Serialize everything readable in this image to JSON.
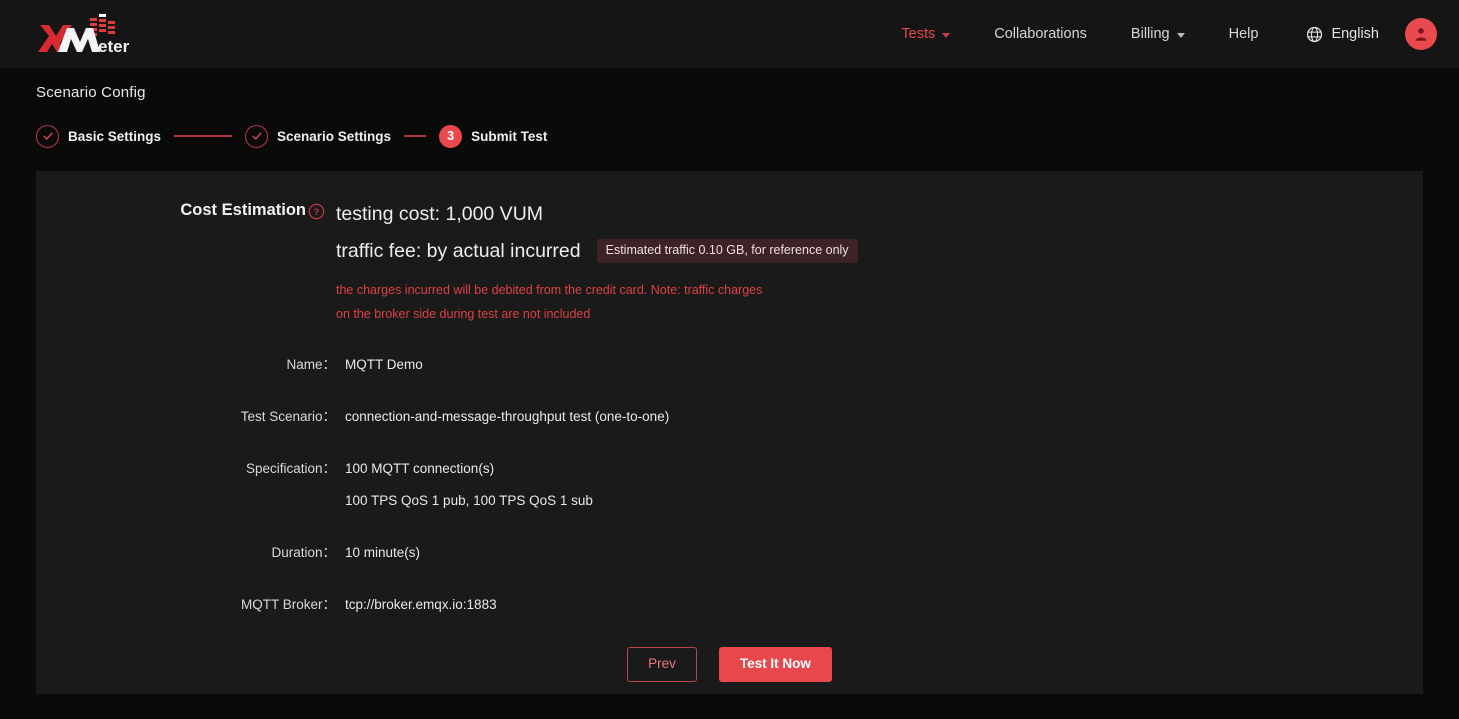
{
  "header": {
    "logo": {
      "name": "XMeter",
      "part_x": "X",
      "part_m": "M",
      "part_eter": "eter"
    },
    "nav": [
      {
        "label": "Tests",
        "active": true,
        "has_caret": true
      },
      {
        "label": "Collaborations",
        "active": false,
        "has_caret": false
      },
      {
        "label": "Billing",
        "active": false,
        "has_caret": true
      },
      {
        "label": "Help",
        "active": false,
        "has_caret": false
      }
    ],
    "language": "English",
    "language_icon": "globe-icon",
    "avatar_icon": "user-avatar-icon"
  },
  "page": {
    "title": "Scenario Config"
  },
  "steps": [
    {
      "label": "Basic Settings",
      "state": "done",
      "marker": "✓"
    },
    {
      "label": "Scenario Settings",
      "state": "done",
      "marker": "✓"
    },
    {
      "label": "Submit Test",
      "state": "current",
      "marker": "3"
    }
  ],
  "cost": {
    "label": "Cost Estimation",
    "help_icon": "question-circle-icon",
    "testing_cost": "testing cost: 1,000 VUM",
    "traffic_fee": "traffic fee: by actual incurred",
    "traffic_badge": "Estimated traffic 0.10 GB, for reference only",
    "note_line1": "the charges incurred will be debited from the credit card. Note: traffic charges",
    "note_line2": "on the broker side during test are not included"
  },
  "details": [
    {
      "label": "Name：",
      "value": "MQTT Demo",
      "sub": ""
    },
    {
      "label": "Test Scenario：",
      "value": "connection-and-message-throughput test (one-to-one)",
      "sub": ""
    },
    {
      "label": "Specification：",
      "value": "100 MQTT connection(s)",
      "sub": "100 TPS QoS 1 pub, 100 TPS QoS 1 sub"
    },
    {
      "label": "Duration：",
      "value": "10 minute(s)",
      "sub": ""
    },
    {
      "label": "MQTT Broker：",
      "value": "tcp://broker.emqx.io:1883",
      "sub": ""
    }
  ],
  "actions": {
    "prev_label": "Prev",
    "submit_label": "Test It Now"
  },
  "colors": {
    "accent": "#e8484b",
    "accent_text": "#dc4146",
    "page_bg": "#0a0a0a",
    "card_bg": "#1a1a1a",
    "header_bg": "#151515",
    "badge_bg": "#3c2325"
  }
}
